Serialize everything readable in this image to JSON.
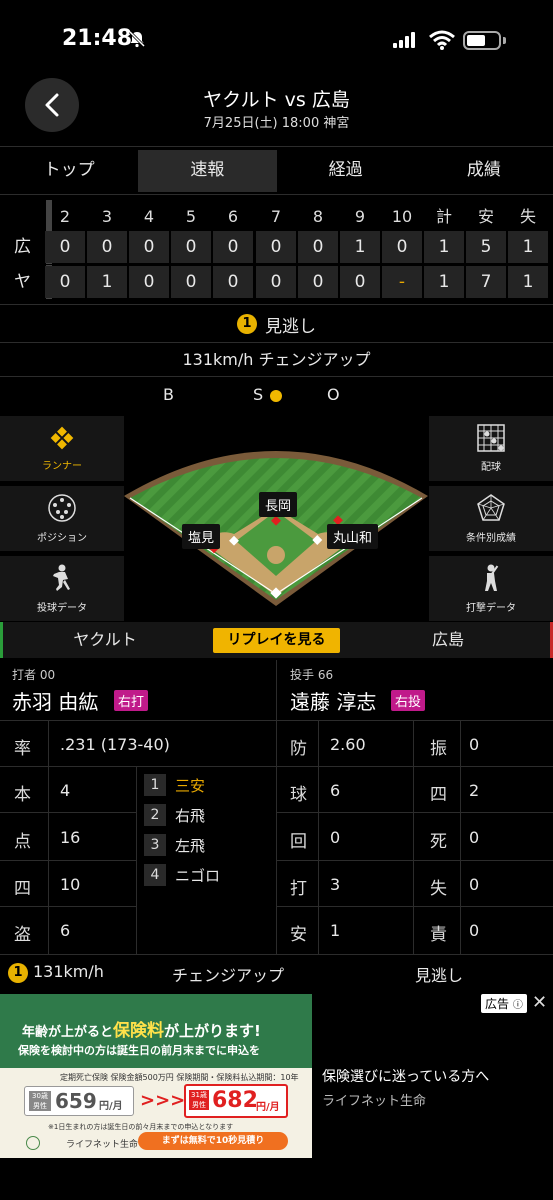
{
  "status": {
    "time": "21:48"
  },
  "header": {
    "title": "ヤクルト vs 広島",
    "subtitle": "7月25日(土) 18:00 神宮"
  },
  "tabs": [
    {
      "label": "トップ"
    },
    {
      "label": "速報"
    },
    {
      "label": "経過"
    },
    {
      "label": "成績"
    }
  ],
  "scoreboard": {
    "columns": [
      "2",
      "3",
      "4",
      "5",
      "6",
      "7",
      "8",
      "9",
      "10",
      "計",
      "安",
      "失"
    ],
    "rows": [
      {
        "team": "広",
        "values": [
          "0",
          "0",
          "0",
          "0",
          "0",
          "0",
          "0",
          "1",
          "0",
          "1",
          "5",
          "1"
        ]
      },
      {
        "team": "ヤ",
        "values": [
          "0",
          "1",
          "0",
          "0",
          "0",
          "0",
          "0",
          "0",
          "-",
          "1",
          "7",
          "1"
        ]
      }
    ]
  },
  "pitch": {
    "number": "1",
    "result": "見逃し",
    "type": "131km/h チェンジアップ",
    "count_b": "B",
    "count_s": "S",
    "count_o": "O"
  },
  "side_left": [
    {
      "label": "ランナー",
      "icon": "diamond-grid-icon"
    },
    {
      "label": "ポジション",
      "icon": "positions-icon"
    },
    {
      "label": "投球データ",
      "icon": "pitcher-icon"
    }
  ],
  "side_right": [
    {
      "label": "配球",
      "icon": "pitch-grid-icon"
    },
    {
      "label": "条件別成績",
      "icon": "radar-chart-icon"
    },
    {
      "label": "打撃データ",
      "icon": "batter-icon"
    }
  ],
  "fielders": {
    "cf": "長岡",
    "lf": "塩見",
    "rf": "丸山和"
  },
  "teambar": {
    "left": "ヤクルト",
    "replay": "リプレイを見る",
    "right": "広島"
  },
  "batter": {
    "label": "打者 00",
    "name": "赤羽 由紘",
    "hand": "右打",
    "stats": [
      {
        "k": "率",
        "v": ".231 (173-40)"
      },
      {
        "k": "本",
        "v": "4"
      },
      {
        "k": "点",
        "v": "16"
      },
      {
        "k": "四",
        "v": "10"
      },
      {
        "k": "盗",
        "v": "6"
      }
    ],
    "history": [
      {
        "n": "1",
        "r": "三安"
      },
      {
        "n": "2",
        "r": "右飛"
      },
      {
        "n": "3",
        "r": "左飛"
      },
      {
        "n": "4",
        "r": "ニゴロ"
      }
    ]
  },
  "pitcher": {
    "label": "投手 66",
    "name": "遠藤 淳志",
    "hand": "右投",
    "stats_a": [
      {
        "k": "防",
        "v": "2.60"
      },
      {
        "k": "球",
        "v": "6"
      },
      {
        "k": "回",
        "v": "0"
      },
      {
        "k": "打",
        "v": "3"
      },
      {
        "k": "安",
        "v": "1"
      }
    ],
    "stats_b": [
      {
        "k": "振",
        "v": "0"
      },
      {
        "k": "四",
        "v": "2"
      },
      {
        "k": "死",
        "v": "0"
      },
      {
        "k": "失",
        "v": "0"
      },
      {
        "k": "責",
        "v": "0"
      }
    ]
  },
  "summary": {
    "num": "1",
    "speed": "131km/h",
    "type": "チェンジアップ",
    "result": "見逃し"
  },
  "ad": {
    "badge": "広告",
    "headline1": "年齢が上がると",
    "headline2": "保険料",
    "headline3": "が上がります!",
    "line2": "保険を検討中の方は誕生日の前月末までに申込を",
    "plan": "定期死亡保険 保険金額500万円 保険期間・保険料払込期間：10年",
    "age_a": "30歳 男性",
    "price_a": "659",
    "age_b": "31歳 男性",
    "price_b": "682",
    "unit": "円/月",
    "note": "※1日生まれの方は誕生日の前々月末までの申込となります",
    "brand_small": "ライフネット生命",
    "cta": "まずは無料で10秒見積り",
    "side_title": "保険選びに迷っている方へ",
    "side_brand": "ライフネット生命"
  }
}
